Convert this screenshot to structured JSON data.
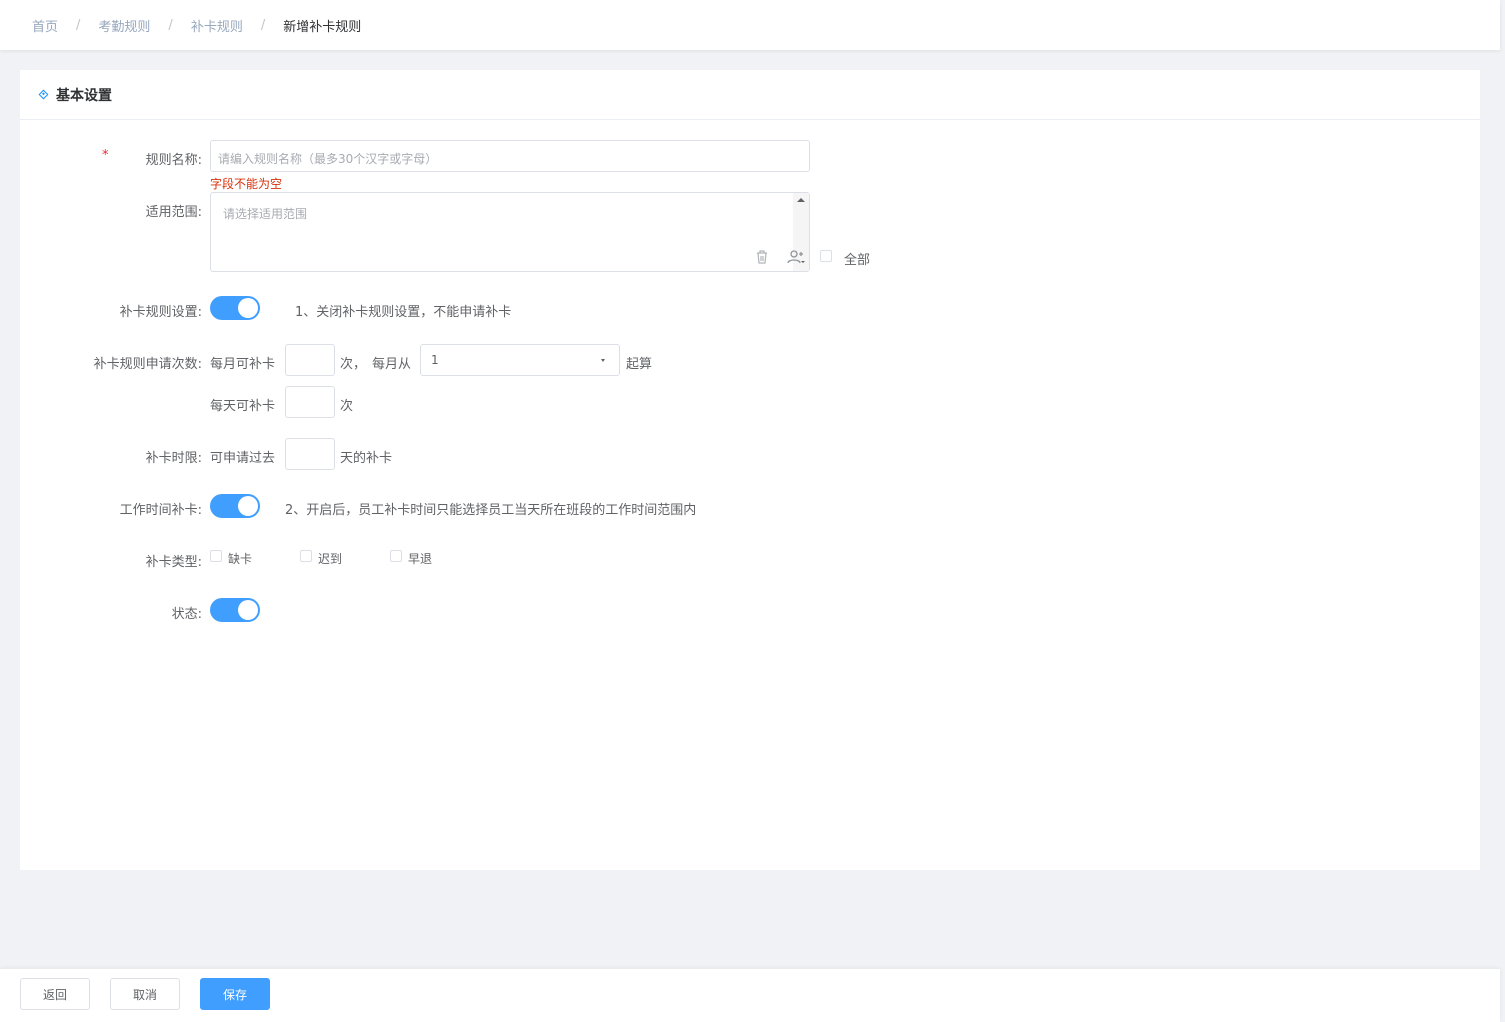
{
  "breadcrumb": [
    "首页",
    "考勤规则",
    "补卡规则",
    "新增补卡规则"
  ],
  "breadcrumb_separator": "/",
  "section": {
    "title": "基本设置"
  },
  "form": {
    "rule_name": {
      "required_mark": "*",
      "label": "规则名称:",
      "placeholder": "请编入规则名称（最多30个汉字或字母）",
      "error": "字段不能为空"
    },
    "scope": {
      "label": "适用范围:",
      "placeholder": "请选择适用范围",
      "all_label": "全部"
    },
    "rule_setting": {
      "label": "补卡规则设置:",
      "enabled": true,
      "hint": "1、关闭补卡规则设置，不能申请补卡"
    },
    "apply_count": {
      "label": "补卡规则申请次数:",
      "monthly_prefix": "每月可补卡",
      "monthly_unit": "次，",
      "from_label": "每月从",
      "from_value": "1",
      "from_suffix": "起算",
      "daily_prefix": "每天可补卡",
      "daily_unit": "次"
    },
    "time_limit": {
      "label": "补卡时限:",
      "prefix": "可申请过去",
      "suffix": "天的补卡"
    },
    "work_time": {
      "label": "工作时间补卡:",
      "enabled": true,
      "hint": "2、开启后，员工补卡时间只能选择员工当天所在班段的工作时间范围内"
    },
    "types": {
      "label": "补卡类型:",
      "options": [
        "缺卡",
        "迟到",
        "早退"
      ]
    },
    "status": {
      "label": "状态:",
      "enabled": true
    }
  },
  "footer": {
    "back": "返回",
    "cancel": "取消",
    "save": "保存"
  },
  "colors": {
    "primary": "#409eff",
    "error": "#d7310b",
    "required": "#f5222d"
  }
}
